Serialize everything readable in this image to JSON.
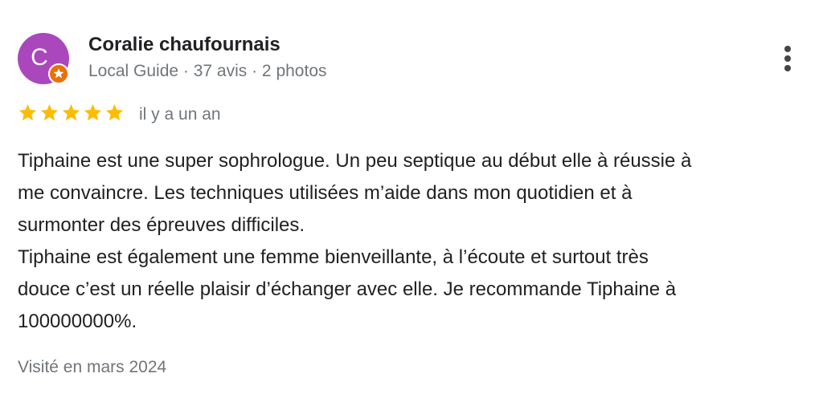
{
  "author": {
    "avatar_letter": "C",
    "avatar_color": "#ab47bc",
    "name": "Coralie chaufournais",
    "meta": "Local Guide · 37 avis · 2 photos",
    "badge_icon": "local-guide-star-badge"
  },
  "review": {
    "rating": 5,
    "max_rating": 5,
    "star_color": "#fbbc04",
    "time": "il y a un an",
    "text_lines": [
      "Tiphaine est une super sophrologue. Un peu septique au début elle à réussie à",
      "me convaincre. Les techniques utilisées m’aide dans mon quotidien et à",
      "surmonter des épreuves difficiles.",
      "Tiphaine est également une femme bienveillante, à l’écoute et surtout très",
      "douce c’est un réelle plaisir d’échanger avec elle. Je recommande Tiphaine à",
      "100000000%."
    ],
    "visited": "Visité en mars 2024"
  },
  "menu": {
    "icon": "more-vert-icon"
  }
}
